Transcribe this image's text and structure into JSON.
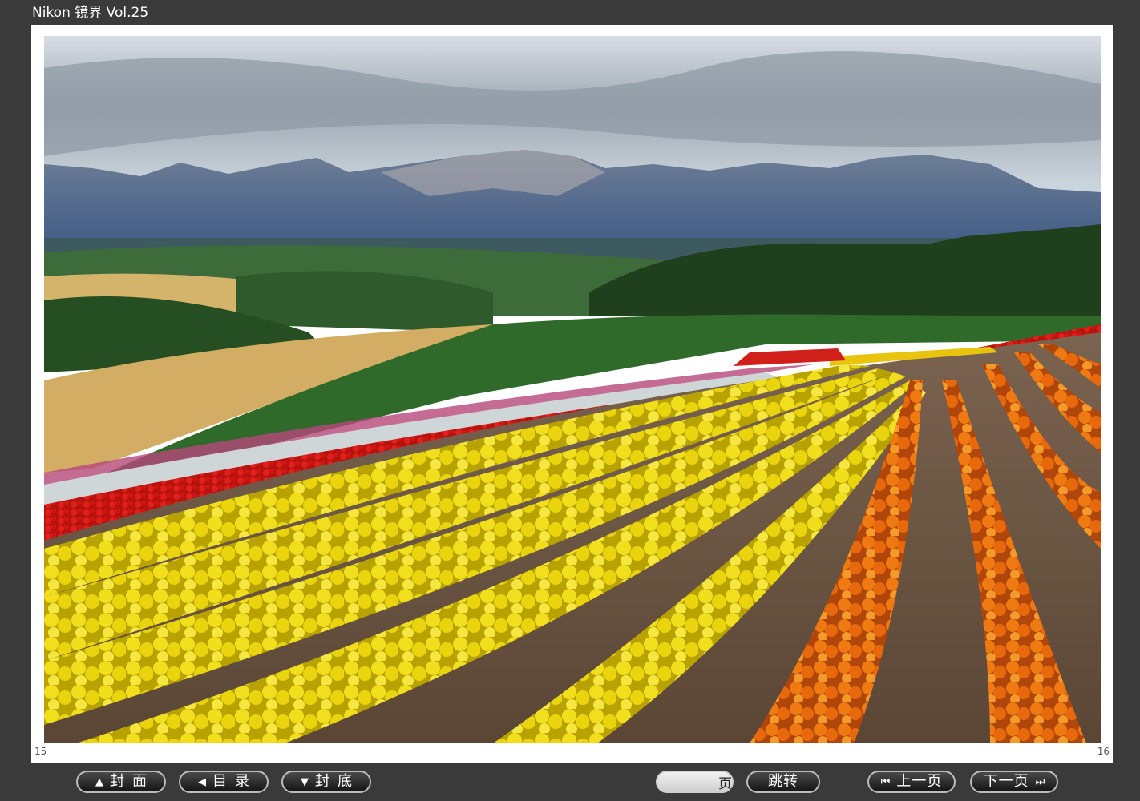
{
  "window": {
    "title": "Nikon 镜界 Vol.25"
  },
  "page": {
    "left_number": "15",
    "right_number": "16"
  },
  "photo": {
    "subject": ""
  },
  "nav": {
    "cover_label": "封面",
    "toc_label": "目录",
    "back_cover_label": "封底",
    "page_unit": "页",
    "page_value": "",
    "jump_label": "跳转",
    "prev_label": "上一页",
    "next_label": "下一页"
  },
  "icons": {
    "cover": "triangle-up-icon",
    "toc": "triangle-left-icon",
    "back_cover": "triangle-down-icon",
    "prev": "skip-back-icon",
    "next": "skip-forward-icon"
  }
}
